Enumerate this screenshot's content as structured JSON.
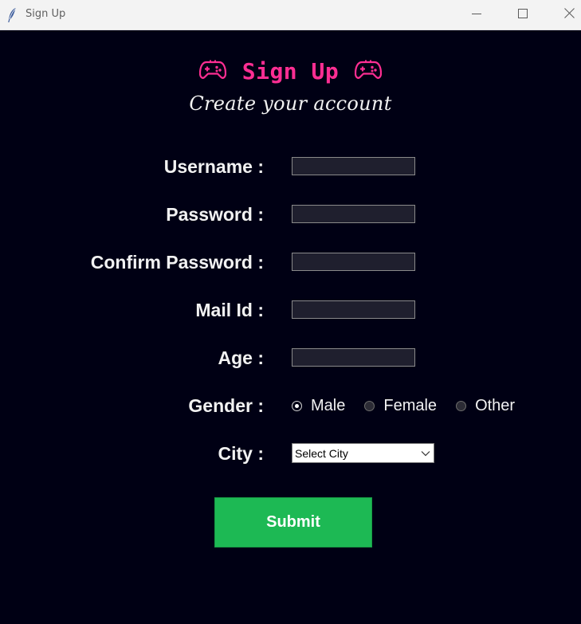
{
  "window": {
    "title": "Sign Up",
    "controls": [
      "minimize-icon",
      "maximize-icon",
      "close-icon"
    ],
    "app_icon": "feather-icon"
  },
  "header": {
    "title": "Sign Up",
    "subtitle": "Create your account",
    "icon": "gamepad-icon",
    "title_color": "#ff2e93"
  },
  "form": {
    "username_label": "Username :",
    "password_label": "Password :",
    "confirm_password_label": "Confirm Password :",
    "mail_label": "Mail Id :",
    "age_label": "Age :",
    "gender_label": "Gender :",
    "city_label": "City :",
    "username_value": "",
    "password_value": "",
    "confirm_password_value": "",
    "mail_value": "",
    "age_value": "",
    "gender_options": [
      "Male",
      "Female",
      "Other"
    ],
    "gender_selected": "Male",
    "city_selected": "Select City",
    "submit_label": "Submit"
  },
  "colors": {
    "background": "#000014",
    "entry_background": "#1f1f2e",
    "submit_background": "#1db954",
    "text": "#f2f2f2"
  }
}
